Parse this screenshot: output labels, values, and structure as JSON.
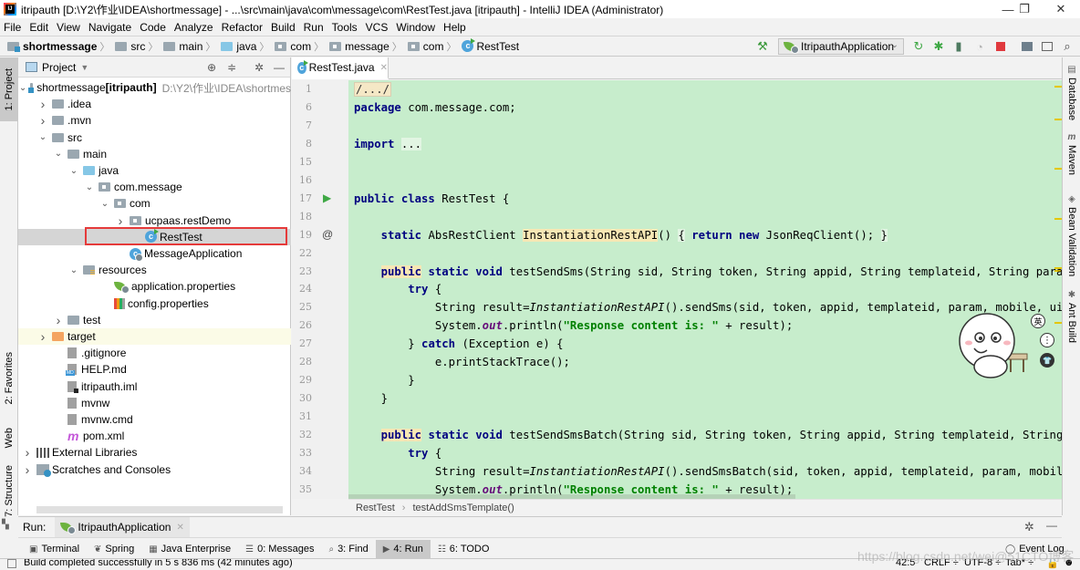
{
  "window": {
    "title": "itripauth [D:\\Y2\\作业\\IDEA\\shortmessage] - ...\\src\\main\\java\\com\\message\\com\\RestTest.java [itripauth] - IntelliJ IDEA (Administrator)",
    "controls": {
      "minimize": "—",
      "restore": "❐",
      "close": "✕"
    }
  },
  "menu": [
    "File",
    "Edit",
    "View",
    "Navigate",
    "Code",
    "Analyze",
    "Refactor",
    "Build",
    "Run",
    "Tools",
    "VCS",
    "Window",
    "Help"
  ],
  "breadcrumb": [
    "shortmessage",
    "src",
    "main",
    "java",
    "com",
    "message",
    "com",
    "RestTest"
  ],
  "toolbar": {
    "run_config": "ItripauthApplication",
    "icons": [
      "build-hammer",
      "rerun",
      "debug",
      "coverage",
      "profile",
      "stop",
      "project-structure",
      "terminal",
      "search"
    ]
  },
  "left_strip": {
    "project": "1: Project",
    "favorites": "2: Favorites",
    "web": "Web",
    "structure": "7: Structure"
  },
  "project_panel": {
    "title": "Project",
    "tree": [
      {
        "label": "shortmessage",
        "bold_suffix": "[itripauth]",
        "path": "D:\\Y2\\作业\\IDEA\\shortmes",
        "depth": 0,
        "arrow": "down",
        "icon": "project-folder"
      },
      {
        "label": ".idea",
        "depth": 1,
        "arrow": "right",
        "icon": "folder"
      },
      {
        "label": ".mvn",
        "depth": 1,
        "arrow": "right",
        "icon": "folder"
      },
      {
        "label": "src",
        "depth": 1,
        "arrow": "down",
        "icon": "folder"
      },
      {
        "label": "main",
        "depth": 2,
        "arrow": "down",
        "icon": "folder"
      },
      {
        "label": "java",
        "depth": 3,
        "arrow": "down",
        "icon": "source-folder"
      },
      {
        "label": "com.message",
        "depth": 4,
        "arrow": "down",
        "icon": "package"
      },
      {
        "label": "com",
        "depth": 5,
        "arrow": "down",
        "icon": "package"
      },
      {
        "label": "ucpaas.restDemo",
        "depth": 6,
        "arrow": "right",
        "icon": "package"
      },
      {
        "label": "RestTest",
        "depth": 7,
        "arrow": "",
        "icon": "class-run",
        "selected": true
      },
      {
        "label": "MessageApplication",
        "depth": 6,
        "arrow": "",
        "icon": "class-spring"
      },
      {
        "label": "resources",
        "depth": 3,
        "arrow": "down",
        "icon": "resources-folder"
      },
      {
        "label": "application.properties",
        "depth": 5,
        "arrow": "",
        "icon": "spring-properties"
      },
      {
        "label": "config.properties",
        "depth": 5,
        "arrow": "",
        "icon": "properties"
      },
      {
        "label": "test",
        "depth": 2,
        "arrow": "right",
        "icon": "folder"
      },
      {
        "label": "target",
        "depth": 1,
        "arrow": "right",
        "icon": "excluded-folder",
        "excluded": true
      },
      {
        "label": ".gitignore",
        "depth": 2,
        "arrow": "",
        "icon": "file"
      },
      {
        "label": "HELP.md",
        "depth": 2,
        "arrow": "",
        "icon": "md-file"
      },
      {
        "label": "itripauth.iml",
        "depth": 2,
        "arrow": "",
        "icon": "iml-file"
      },
      {
        "label": "mvnw",
        "depth": 2,
        "arrow": "",
        "icon": "file"
      },
      {
        "label": "mvnw.cmd",
        "depth": 2,
        "arrow": "",
        "icon": "file"
      },
      {
        "label": "pom.xml",
        "depth": 2,
        "arrow": "",
        "icon": "maven-file"
      },
      {
        "label": "External Libraries",
        "depth": 0,
        "arrow": "right",
        "icon": "libraries"
      },
      {
        "label": "Scratches and Consoles",
        "depth": 0,
        "arrow": "right",
        "icon": "scratches"
      }
    ]
  },
  "editor": {
    "tab": "RestTest.java",
    "lines": [
      {
        "n": "1",
        "html": "<span class=\"folded\">/.../</span>"
      },
      {
        "n": "6",
        "html": "<span class=\"kw\">package</span> com.message.com;"
      },
      {
        "n": "7",
        "html": ""
      },
      {
        "n": "8",
        "html": "<span class=\"kw\">import</span> <span class=\"hl-box\">...</span>"
      },
      {
        "n": "15",
        "html": ""
      },
      {
        "n": "16",
        "html": ""
      },
      {
        "n": "17",
        "html": "<span class=\"kw\">public class</span> RestTest {",
        "gutter": "run"
      },
      {
        "n": "18",
        "html": ""
      },
      {
        "n": "19",
        "html": "    <span class=\"kw\">static</span> AbsRestClient <span class=\"hl-yellow\">InstantiationRestAPI</span>() <span class=\"hl-box\">{</span> <span class=\"kw\">return new</span> JsonReqClient(); <span class=\"hl-box\">}</span>",
        "gutter": "at"
      },
      {
        "n": "22",
        "html": ""
      },
      {
        "n": "23",
        "html": "    <span class=\"kw\"><span class=\"hl-yellow\">public</span> static void</span> testSendSms(String sid, String token, String appid, String templateid, String param, String mobile, String uid) {"
      },
      {
        "n": "24",
        "html": "        <span class=\"kw\">try</span> {"
      },
      {
        "n": "25",
        "html": "            String result=<span class=\"it\">InstantiationRestAPI</span>().sendSms(sid, token, appid, templateid, param, mobile, uid);"
      },
      {
        "n": "26",
        "html": "            System.<span class=\"field\">out</span>.println(<span class=\"str\">\"Response content is: \"</span> + result);"
      },
      {
        "n": "27",
        "html": "        } <span class=\"kw\">catch</span> (Exception e) {"
      },
      {
        "n": "28",
        "html": "            e.printStackTrace();"
      },
      {
        "n": "29",
        "html": "        }"
      },
      {
        "n": "30",
        "html": "    }"
      },
      {
        "n": "31",
        "html": ""
      },
      {
        "n": "32",
        "html": "    <span class=\"kw\"><span class=\"hl-yellow\">public</span> static void</span> testSendSmsBatch(String sid, String token, String appid, String templateid, String param, String mobile, String uid) {"
      },
      {
        "n": "33",
        "html": "        <span class=\"kw\">try</span> {"
      },
      {
        "n": "34",
        "html": "            String result=<span class=\"it\">InstantiationRestAPI</span>().sendSmsBatch(sid, token, appid, templateid, param, mobile, uid);"
      },
      {
        "n": "35",
        "html": "            System.<span class=\"field\">out</span>.println(<span class=\"str\">\"Response content is: \"</span> + result);"
      }
    ],
    "breadcrumb": [
      "RestTest",
      "testAddSmsTemplate()"
    ]
  },
  "mascot_buttons": [
    "英",
    "⋮",
    "👕"
  ],
  "right_strip": [
    "Database",
    "Maven",
    "Bean Validation",
    "Ant Build"
  ],
  "run_panel": {
    "label": "Run:",
    "tab": "ItripauthApplication"
  },
  "tool_windows": [
    {
      "label": "Terminal",
      "icon": "terminal-icon"
    },
    {
      "label": "Spring",
      "icon": "spring-icon"
    },
    {
      "label": "Java Enterprise",
      "icon": "java-enterprise-icon"
    },
    {
      "label": "0: Messages",
      "icon": "messages-icon"
    },
    {
      "label": "3: Find",
      "icon": "find-icon"
    },
    {
      "label": "4: Run",
      "icon": "run-icon",
      "active": true
    },
    {
      "label": "6: TODO",
      "icon": "todo-icon"
    }
  ],
  "event_log": "Event Log",
  "status": {
    "message": "Build completed successfully in 5 s 836 ms (42 minutes ago)",
    "position": "42:5",
    "line_separator": "CRLF ÷",
    "encoding": "UTF-8 ÷",
    "indent": "Tab* ÷"
  },
  "watermark": "https://blog.csdn.net/wei@51CTO博客"
}
